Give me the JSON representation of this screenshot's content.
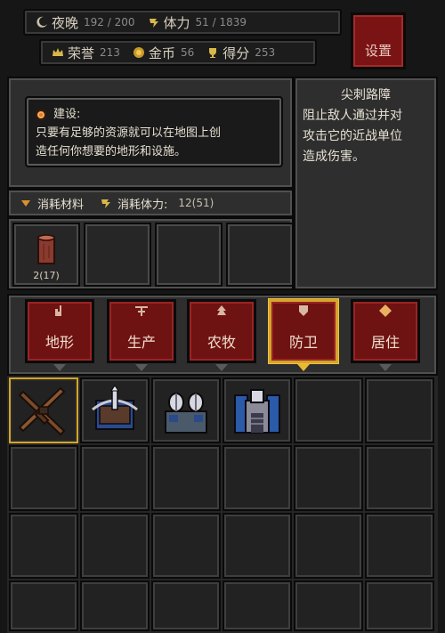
{
  "hud": {
    "night_label": "夜晚",
    "night_value": "192 / 200",
    "stamina_label": "体力",
    "stamina_value": "51 / 1839",
    "honor_label": "荣誉",
    "honor_value": "213",
    "gold_label": "金币",
    "gold_value": "56",
    "score_label": "得分",
    "score_value": "253",
    "settings_label": "设置"
  },
  "hint": {
    "title": "建设:",
    "line1": "只要有足够的资源就可以在地图上创",
    "line2": "造任何你想要的地形和设施。"
  },
  "description": {
    "title": "尖刺路障",
    "lines": [
      "阻止敌人通过并对",
      "攻击它的近战单位",
      "造成伤害。"
    ]
  },
  "cost": {
    "materials_label": "消耗材料",
    "stamina_label": "消耗体力:",
    "stamina_value": "12(51)"
  },
  "materials": [
    {
      "name": "wood-log",
      "count": "2(17)"
    }
  ],
  "categories": [
    {
      "label": "地形",
      "icon": "terrain-icon",
      "active": false
    },
    {
      "label": "生产",
      "icon": "production-icon",
      "active": false
    },
    {
      "label": "农牧",
      "icon": "farming-icon",
      "active": false
    },
    {
      "label": "防卫",
      "icon": "defense-icon",
      "active": true
    },
    {
      "label": "居住",
      "icon": "housing-icon",
      "active": false
    }
  ],
  "buildings": [
    {
      "name": "spike-barricade-icon",
      "selected": true
    },
    {
      "name": "ballista-icon",
      "selected": false
    },
    {
      "name": "tesla-tower-icon",
      "selected": false
    },
    {
      "name": "blue-fortress-icon",
      "selected": false
    }
  ],
  "colors": {
    "accent_gold": "#d4a52a",
    "button_red": "#6e1212",
    "panel_gray": "#2e2e2e"
  }
}
